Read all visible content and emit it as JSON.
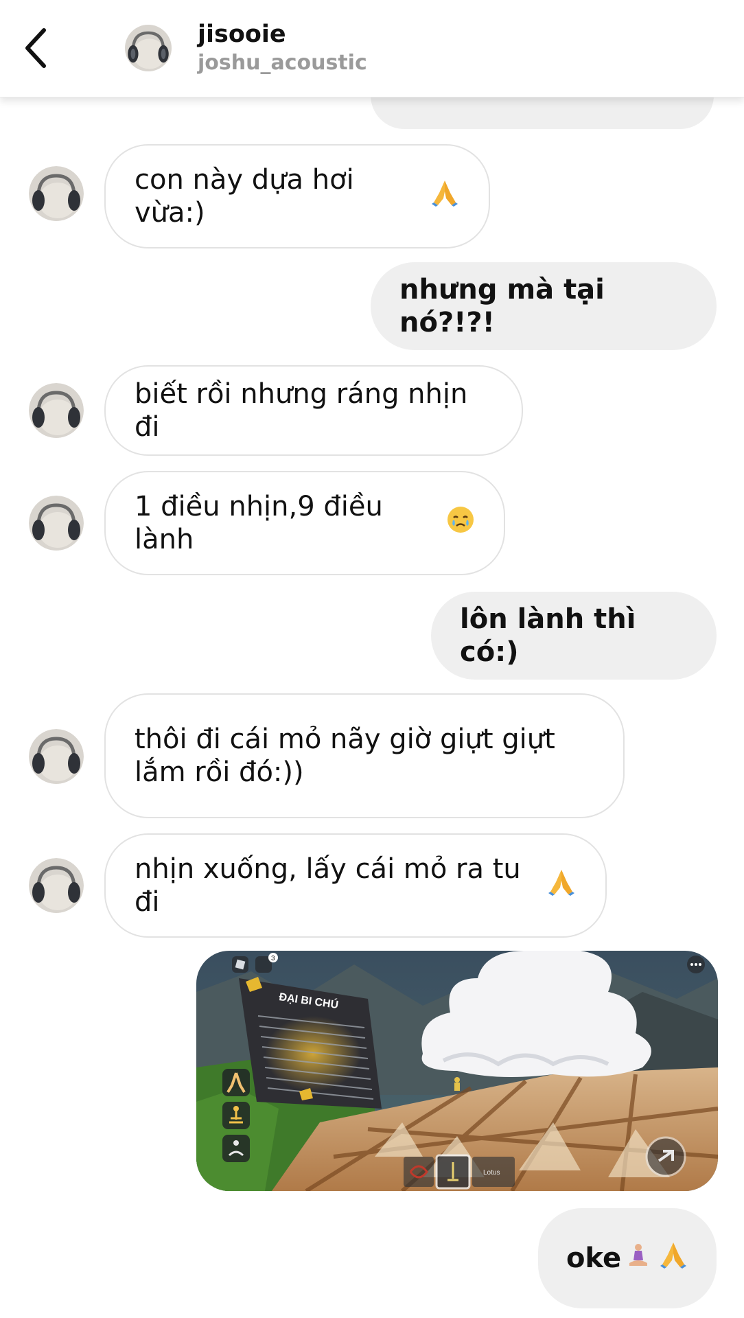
{
  "header": {
    "title": "jisooie",
    "subtitle": "joshu_acoustic"
  },
  "messages": [
    {
      "id": "m1",
      "side": "in",
      "text": "con này dựa hơi vừa:)",
      "emoji": "folded-hands"
    },
    {
      "id": "m2",
      "side": "out",
      "text": "nhưng mà tại nó?!?!"
    },
    {
      "id": "m3",
      "side": "in",
      "text": "biết rồi nhưng ráng nhịn đi"
    },
    {
      "id": "m4",
      "side": "in",
      "text": "1 điều nhịn,9 điều lành",
      "emoji": "face-holding-back-tears"
    },
    {
      "id": "m5",
      "side": "out",
      "text": "lôn lành thì có:)"
    },
    {
      "id": "m6",
      "side": "in",
      "text": "thôi đi cái mỏ nãy giờ giựt giựt\nlắm rồi đó:))"
    },
    {
      "id": "m7",
      "side": "in",
      "text": "nhịn xuống, lấy cái mỏ ra tu đi",
      "emoji": "folded-hands"
    },
    {
      "id": "m8",
      "side": "out",
      "type": "image",
      "image": {
        "sign_title": "ĐẠI BI CHÚ",
        "notification_count": "3",
        "hotbar_label": "Lotus"
      }
    },
    {
      "id": "m9",
      "side": "out",
      "text": "oke",
      "emoji": [
        "person-in-lotus-position",
        "folded-hands"
      ]
    }
  ],
  "colors": {
    "incoming_bg": "#ffffff",
    "incoming_border": "#e2e2e2",
    "outgoing_bg": "#efefef",
    "subtitle": "#9a9a9a"
  }
}
